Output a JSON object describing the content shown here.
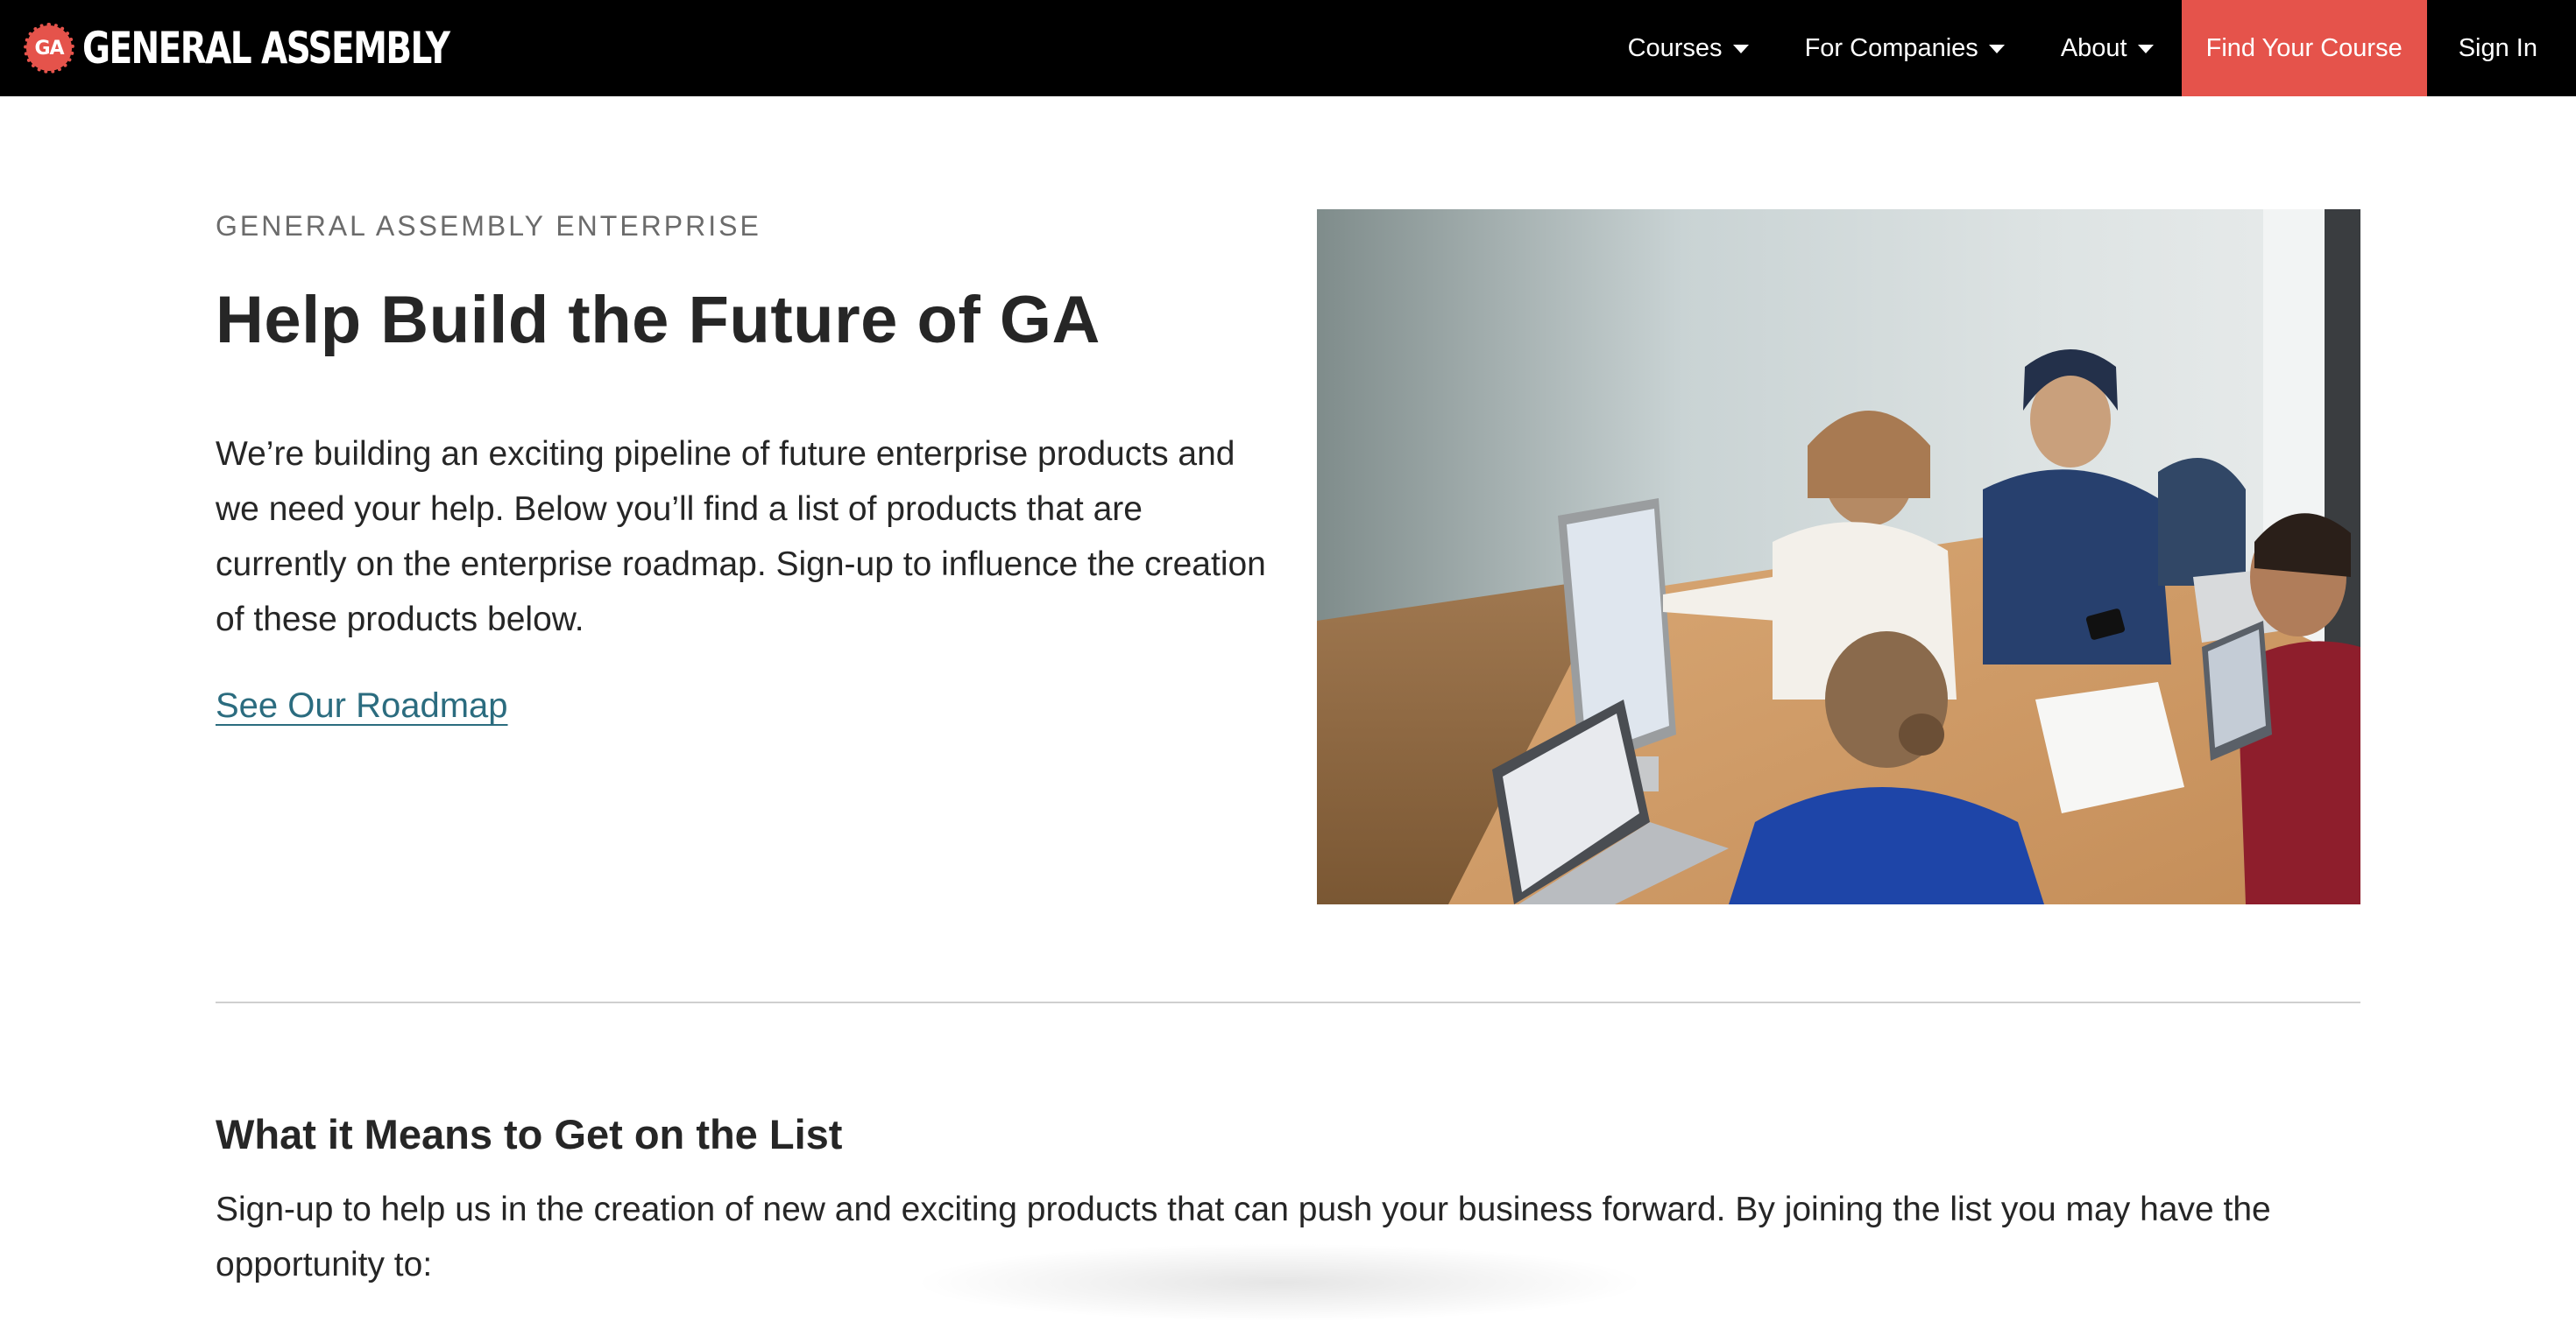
{
  "nav": {
    "brand_initials": "GA",
    "brand_name": "GENERAL ASSEMBLY",
    "items": [
      {
        "label": "Courses"
      },
      {
        "label": "For Companies"
      },
      {
        "label": "About"
      }
    ],
    "cta_label": "Find Your Course",
    "signin_label": "Sign In"
  },
  "hero": {
    "eyebrow": "GENERAL ASSEMBLY ENTERPRISE",
    "title": "Help Build the Future of GA",
    "body": "We’re building an exciting pipeline of future enterprise products and we need your help. Below you’ll find a list of products that are currently on the enterprise roadmap. Sign-up to influence the creation of these products below.",
    "link_label": "See Our Roadmap"
  },
  "section": {
    "title": "What it Means to Get on the List",
    "body": "Sign-up to help us in the creation of new and exciting products that can push your business forward. By joining the list you may have the opportunity to:"
  },
  "colors": {
    "nav_background": "#000000",
    "brand_accent": "#e5534b",
    "link": "#2b6c7f",
    "text": "#262626",
    "eyebrow": "#6b6b6b"
  }
}
